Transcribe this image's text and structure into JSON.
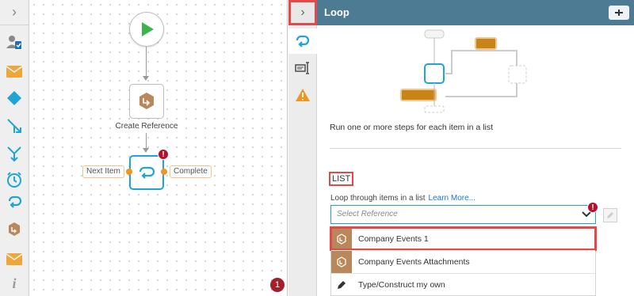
{
  "toolbar": {
    "items": [
      {
        "name": "assign-user-icon"
      },
      {
        "name": "envelope-icon"
      },
      {
        "name": "diamond-decision-icon"
      },
      {
        "name": "branch-split-icon"
      },
      {
        "name": "merge-icon"
      },
      {
        "name": "timer-icon"
      },
      {
        "name": "loop-icon"
      },
      {
        "name": "reference-icon"
      },
      {
        "name": "envelope-icon-2"
      },
      {
        "name": "info-icon"
      }
    ]
  },
  "canvas": {
    "reference_node_label": "Create Reference",
    "loop_error_badge": "!",
    "port_next_item": "Next Item",
    "port_complete": "Complete",
    "notification_count": "1"
  },
  "panel": {
    "title": "Loop",
    "description": "Run one or more steps for each item in a list",
    "section_title": "LIST",
    "field_label": "Loop through items in a list",
    "learn_more": "Learn More...",
    "select_placeholder": "Select Reference",
    "select_error_badge": "!",
    "options": [
      {
        "label": "Company Events 1",
        "icon": "reference-icon"
      },
      {
        "label": "Company Events Attachments",
        "icon": "reference-icon"
      },
      {
        "label": "Type/Construct my own",
        "icon": "pencil-icon"
      }
    ]
  },
  "colors": {
    "header": "#4e7b94",
    "accent": "#1ea5d6",
    "error": "#b40f2b",
    "port": "#f0961e",
    "reference_icon": "#b8875a"
  }
}
